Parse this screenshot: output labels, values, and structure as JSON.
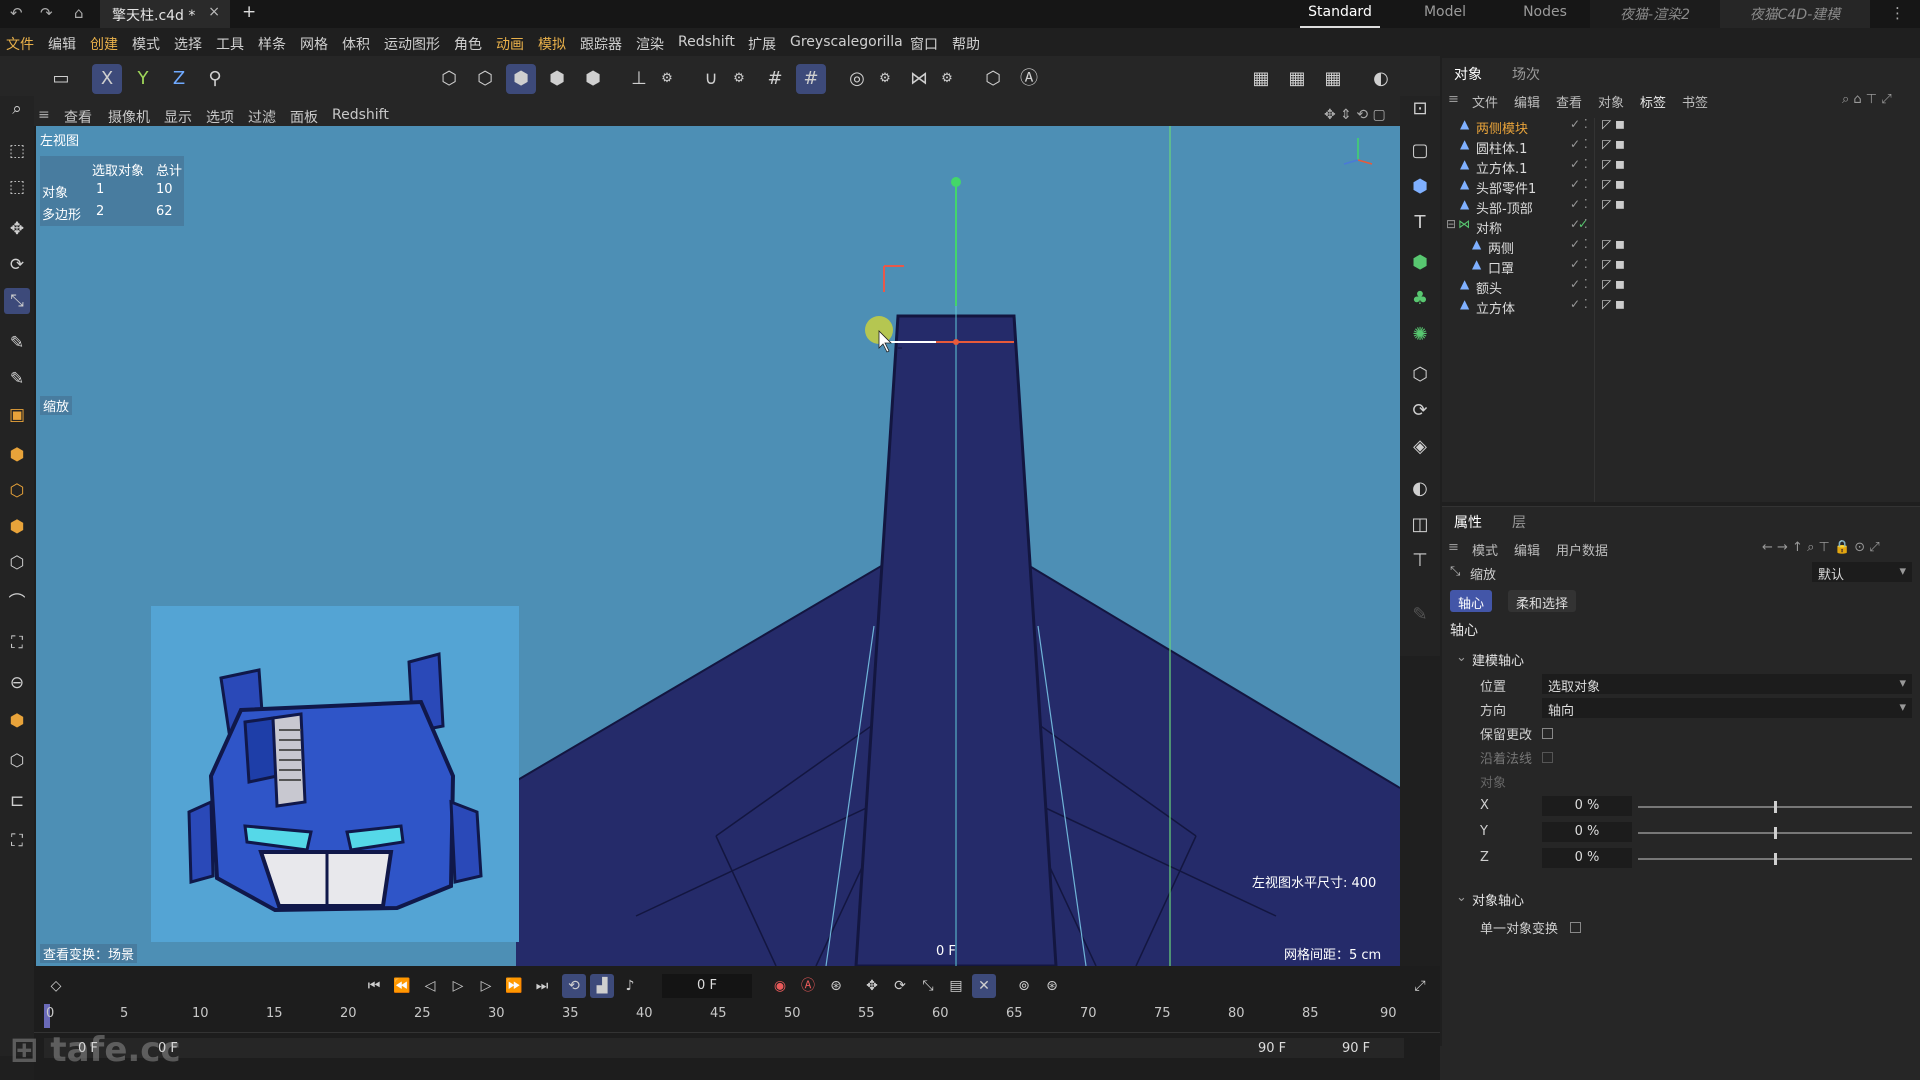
{
  "titlebar": {
    "doc_tab": "擎天柱.c4d *",
    "close": "×",
    "new_tab": "+",
    "workspaces": [
      "Standard",
      "Model",
      "Nodes",
      "夜猫-渲染2",
      "夜猫C4D-建模"
    ],
    "active_workspace": "Standard"
  },
  "menu": [
    "文件",
    "编辑",
    "创建",
    "模式",
    "选择",
    "工具",
    "样条",
    "网格",
    "体积",
    "运动图形",
    "角色",
    "动画",
    "模拟",
    "跟踪器",
    "渲染",
    "Redshift",
    "扩展",
    "Greyscalegorilla",
    "窗口",
    "帮助"
  ],
  "viewmenu": [
    "查看",
    "摄像机",
    "显示",
    "选项",
    "过滤",
    "面板",
    "Redshift"
  ],
  "viewport": {
    "name": "左视图",
    "stats": {
      "col1": "选取对象",
      "col2": "总计",
      "row1_label": "对象",
      "row1_sel": "1",
      "row1_total": "10",
      "row2_label": "多边形",
      "row2_sel": "2",
      "row2_total": "62"
    },
    "tool_label": "缩放",
    "view_transform": "查看变换：场景",
    "frame": "0 F",
    "horiz_size": "左视图水平尺寸:  400",
    "grid_spacing": "网格间距：5 cm",
    "colors": {
      "bg": "#4d8fb5",
      "mesh": "#252b6a",
      "ref_bg": "#54a4d4"
    }
  },
  "objects": {
    "tabs": [
      "对象",
      "场次"
    ],
    "menu": [
      "文件",
      "编辑",
      "查看",
      "对象",
      "标签",
      "书签"
    ],
    "rows": [
      {
        "name": "两侧模块",
        "selected": true,
        "depth": 0
      },
      {
        "name": "圆柱体.1",
        "selected": false,
        "depth": 0
      },
      {
        "name": "立方体.1",
        "selected": false,
        "depth": 0
      },
      {
        "name": "头部零件1",
        "selected": false,
        "depth": 0
      },
      {
        "name": "头部-顶部",
        "selected": false,
        "depth": 0
      },
      {
        "name": "对称",
        "selected": false,
        "depth": 0
      },
      {
        "name": "两侧",
        "selected": false,
        "depth": 1
      },
      {
        "name": "口罩",
        "selected": false,
        "depth": 1
      },
      {
        "name": "额头",
        "selected": false,
        "depth": 0
      },
      {
        "name": "立方体",
        "selected": false,
        "depth": 0
      }
    ]
  },
  "attributes": {
    "tabs": [
      "属性",
      "层"
    ],
    "menu": [
      "模式",
      "编辑",
      "用户数据"
    ],
    "tool": "缩放",
    "preset": "默认",
    "subtabs": [
      "轴心",
      "柔和选择"
    ],
    "section": "轴心",
    "group1": "建模轴心",
    "position_label": "位置",
    "position_value": "选取对象",
    "orient_label": "方向",
    "orient_value": "轴向",
    "keep_changes": "保留更改",
    "along_normals": "沿着法线",
    "object_label": "对象",
    "x_label": "X",
    "x_value": "0 %",
    "y_label": "Y",
    "y_value": "0 %",
    "z_label": "Z",
    "z_value": "0 %",
    "group2": "对象轴心",
    "single_object": "单一对象变换"
  },
  "timeline": {
    "current_frame": "0 F",
    "ticks": [
      "0",
      "5",
      "10",
      "15",
      "20",
      "25",
      "30",
      "35",
      "40",
      "45",
      "50",
      "55",
      "60",
      "65",
      "70",
      "75",
      "80",
      "85",
      "90"
    ],
    "start": "0 F",
    "start2": "0 F",
    "end": "90 F",
    "end2": "90 F"
  },
  "watermark": "tafe.cc"
}
